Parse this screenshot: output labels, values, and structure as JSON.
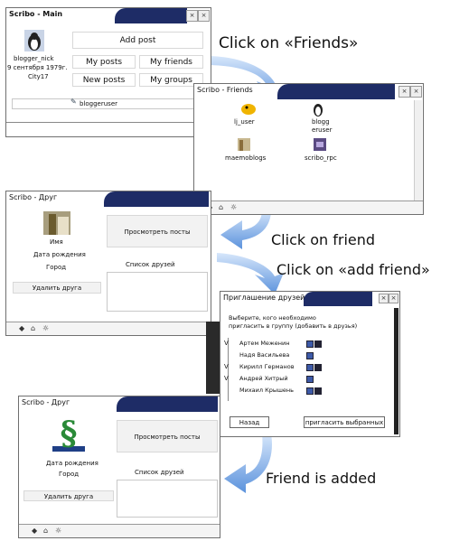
{
  "captions": {
    "c1": "Click on «Friends»",
    "c2": "Click on friend",
    "c3": "Click on «add friend»",
    "c4": "Friend is added"
  },
  "main_window": {
    "title": "Scribo - Main",
    "add_post": "Add post",
    "my_posts": "My posts",
    "my_friends": "My friends",
    "new_posts": "New posts",
    "my_groups": "My groups",
    "username": "blogger_nick",
    "birth": "9 сентября 1979г.",
    "city": "City17",
    "user_field": "bloggeruser"
  },
  "friends_window": {
    "title": "Scribo - Friends",
    "items": [
      {
        "label": "lj_user",
        "icon": "yellow-bird-icon"
      },
      {
        "label": "blogg\neruser",
        "icon": "penguin-icon"
      },
      {
        "label": "maemoblogs",
        "icon": "book-icon"
      },
      {
        "label": "scribo_rpc",
        "icon": "robot-icon"
      }
    ]
  },
  "friend_window_1": {
    "title": "Scribo - Друг",
    "view_posts": "Просмотреть посты",
    "name": "Имя",
    "birth": "Дата рождения",
    "city": "Город",
    "friends_list": "Список друзей",
    "remove": "Удалить друга"
  },
  "invite_dialog": {
    "title": "Приглашение друзей",
    "instruction_1": "Выберите, кого необходимо",
    "instruction_2": "пригласить в группу  (добавить в друзья)",
    "people": [
      {
        "name": "Артем Меженин",
        "checked": "V"
      },
      {
        "name": "Надя Васильева",
        "checked": ""
      },
      {
        "name": "Кирилл Германов",
        "checked": "V"
      },
      {
        "name": "Андрей Хитрый",
        "checked": "V"
      },
      {
        "name": "Михаил Крышень",
        "checked": ""
      }
    ],
    "back": "Назад",
    "invite": "пригласить выбранных"
  },
  "friend_window_2": {
    "title": "Scribo - Друг",
    "view_posts": "Просмотреть посты",
    "birth": "Дата рождения",
    "city": "Город",
    "friends_list": "Список друзей",
    "remove": "Удалить друга"
  },
  "colors": {
    "accent": "#1e2c66",
    "arrow": "#4a86d8"
  }
}
